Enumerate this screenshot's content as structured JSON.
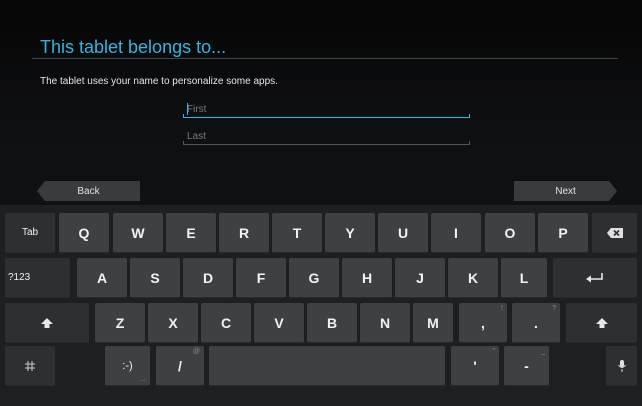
{
  "setup": {
    "title": "This tablet belongs to...",
    "description": "The tablet uses your name to personalize some apps.",
    "first_placeholder": "First",
    "last_placeholder": "Last",
    "back_label": "Back",
    "next_label": "Next"
  },
  "keyboard": {
    "tab_label": "Tab",
    "row1": [
      "Q",
      "W",
      "E",
      "R",
      "T",
      "Y",
      "U",
      "I",
      "O",
      "P"
    ],
    "row2": [
      "A",
      "S",
      "D",
      "F",
      "G",
      "H",
      "J",
      "K",
      "L"
    ],
    "row3": [
      "Z",
      "X",
      "C",
      "V",
      "B",
      "N",
      "M"
    ],
    "symbols_label": "?123",
    "smiley_label": ":-)",
    "slash_label": "/",
    "apostrophe_label": "'",
    "dash_label": "-",
    "comma_label": ",",
    "period_label": ".",
    "hints": {
      "comma": "!",
      "period": "?",
      "slash": "@",
      "apostrophe": "\"",
      "dash": "_",
      "smiley": "..."
    },
    "icons": [
      "backspace-icon",
      "enter-icon",
      "shift-icon",
      "settings-icon",
      "mic-icon"
    ]
  },
  "colors": {
    "accent": "#33b5e5",
    "key": "#3f4044",
    "keyboard_bg": "#1e1f21"
  }
}
